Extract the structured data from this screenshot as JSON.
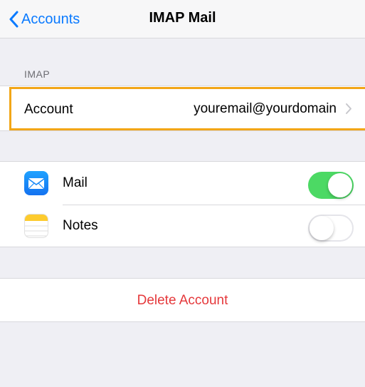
{
  "navbar": {
    "back_label": "Accounts",
    "title": "IMAP Mail",
    "back_icon": "chevron-left-icon"
  },
  "section": {
    "header": "IMAP"
  },
  "account": {
    "label": "Account",
    "value": "youremail@yourdomain",
    "chevron_icon": "chevron-right-icon",
    "highlight_color": "#f2a617"
  },
  "toggles": [
    {
      "label": "Mail",
      "icon": "mail-icon",
      "on": true
    },
    {
      "label": "Notes",
      "icon": "notes-icon",
      "on": false
    }
  ],
  "delete": {
    "label": "Delete Account",
    "color": "#e5383b"
  },
  "colors": {
    "accent": "#0a7aff",
    "toggle_on": "#4cd964",
    "background": "#efeff4"
  }
}
